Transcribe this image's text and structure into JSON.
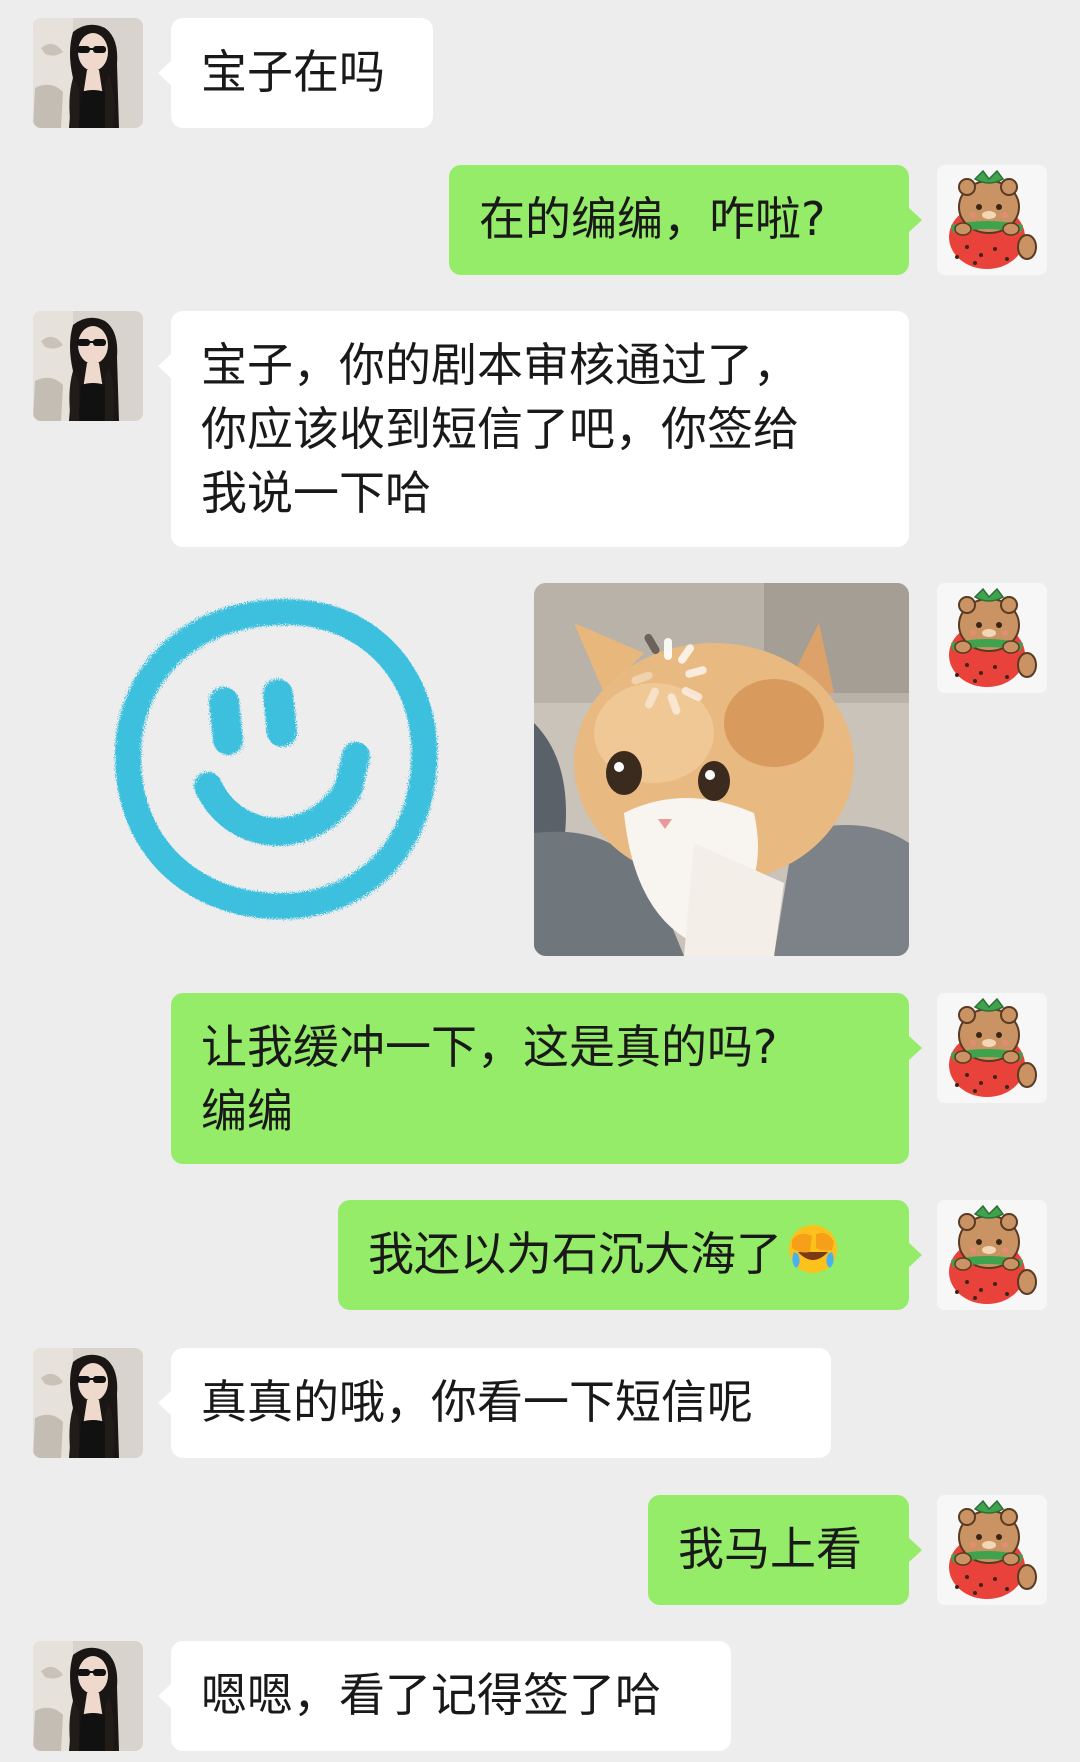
{
  "contacts": {
    "other": {
      "avatar_icon": "girl-sunglasses-avatar"
    },
    "me": {
      "avatar_icon": "strawberry-bear-avatar"
    }
  },
  "messages": [
    {
      "from": "other",
      "type": "text",
      "lines": [
        "宝子在吗"
      ]
    },
    {
      "from": "me",
      "type": "text",
      "lines": [
        "在的编编，咋啦?"
      ]
    },
    {
      "from": "other",
      "type": "text",
      "lines": [
        "宝子，你的剧本审核通过了，",
        "你应该收到短信了吧，你签给",
        "我说一下哈"
      ]
    },
    {
      "from": "me",
      "type": "stickers",
      "stickers": [
        "blue-smiley-sticker",
        "orange-kitten-loading-sticker"
      ]
    },
    {
      "from": "me",
      "type": "text",
      "lines": [
        "让我缓冲一下，这是真的吗?",
        "编编"
      ]
    },
    {
      "from": "me",
      "type": "text",
      "lines": [
        "我还以为石沉大海了"
      ],
      "trailing_emoji": "face-palm-tears-emoji"
    },
    {
      "from": "other",
      "type": "text",
      "lines": [
        "真真的哦，你看一下短信呢"
      ]
    },
    {
      "from": "me",
      "type": "text",
      "lines": [
        "我马上看"
      ]
    },
    {
      "from": "other",
      "type": "text",
      "lines": [
        "嗯嗯，看了记得签了哈"
      ]
    }
  ],
  "colors": {
    "background": "#ededed",
    "incoming_bubble": "#ffffff",
    "outgoing_bubble": "#95ec69",
    "text": "#191919",
    "smiley_blue": "#3cc0de"
  }
}
